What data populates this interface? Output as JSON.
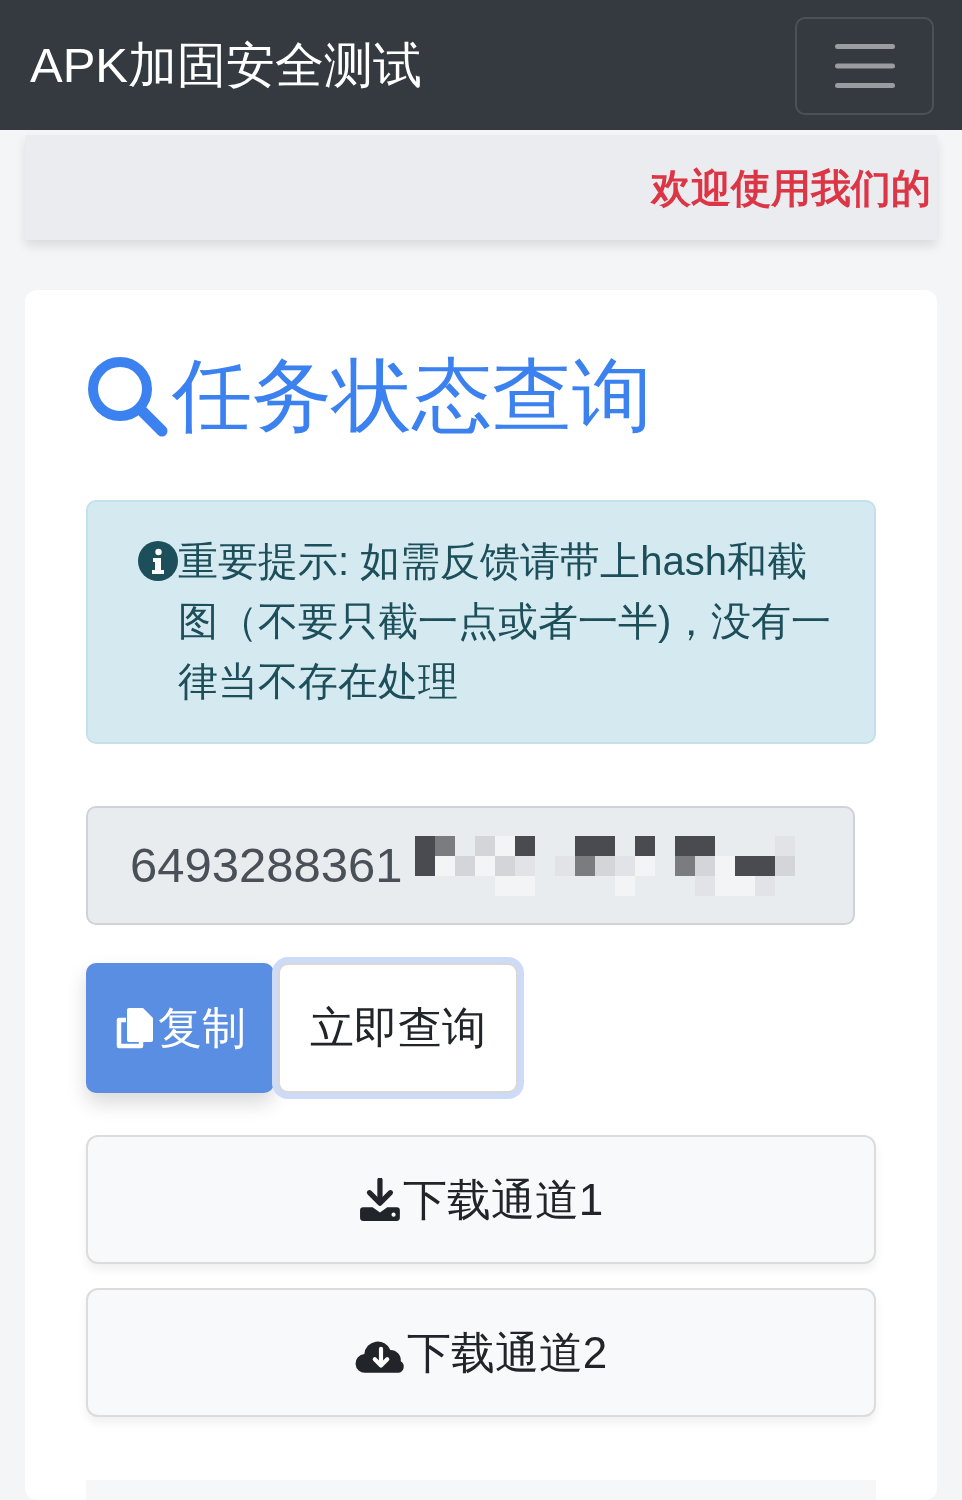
{
  "navbar": {
    "brand": "APK加固安全测试"
  },
  "marquee": {
    "text": "欢迎使用我们的"
  },
  "card": {
    "title": "任务状态查询",
    "notice": {
      "kind": "info",
      "text": "重要提示: 如需反馈请带上hash和截图（不要只截一点或者一半)，没有一律当不存在处理"
    },
    "hash_field": {
      "value": "6493288361",
      "redacted": true
    },
    "actions": [
      {
        "label": "复制",
        "kind": "primary",
        "focused": false
      },
      {
        "label": "立即查询",
        "kind": "outline",
        "focused": true
      }
    ],
    "downloads": [
      {
        "label": "下载通道1"
      },
      {
        "label": "下载通道2"
      }
    ]
  }
}
